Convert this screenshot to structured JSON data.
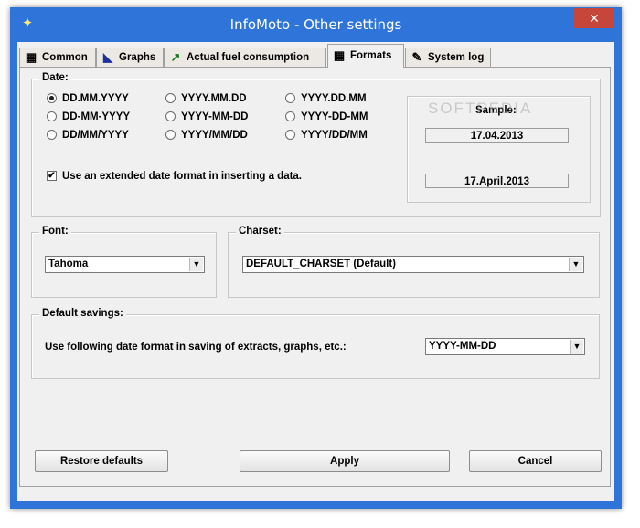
{
  "window": {
    "title": "InfoMoto - Other settings",
    "close_glyph": "✕"
  },
  "tabs": [
    {
      "label": "Common",
      "icon": "grid-icon"
    },
    {
      "label": "Graphs",
      "icon": "chart-icon"
    },
    {
      "label": "Actual fuel consumption",
      "icon": "line-chart-icon"
    },
    {
      "label": "Formats",
      "icon": "grid-icon",
      "active": true
    },
    {
      "label": "System log",
      "icon": "wrench-icon"
    }
  ],
  "date": {
    "group_label": "Date:",
    "formats": [
      {
        "label": "DD.MM.YYYY",
        "selected": true
      },
      {
        "label": "YYYY.MM.DD",
        "selected": false
      },
      {
        "label": "YYYY.DD.MM",
        "selected": false
      },
      {
        "label": "DD-MM-YYYY",
        "selected": false
      },
      {
        "label": "YYYY-MM-DD",
        "selected": false
      },
      {
        "label": "YYYY-DD-MM",
        "selected": false
      },
      {
        "label": "DD/MM/YYYY",
        "selected": false
      },
      {
        "label": "YYYY/MM/DD",
        "selected": false
      },
      {
        "label": "YYYY/DD/MM",
        "selected": false
      }
    ],
    "extended_checkbox_label": "Use an extended date format in inserting a data.",
    "extended_checked": true,
    "sample_label": "Sample:",
    "sample_short": "17.04.2013",
    "sample_long": "17.April.2013"
  },
  "font": {
    "group_label": "Font:",
    "value": "Tahoma"
  },
  "charset": {
    "group_label": "Charset:",
    "value": "DEFAULT_CHARSET (Default)"
  },
  "default_savings": {
    "group_label": "Default savings:",
    "description": "Use following date format in saving of extracts, graphs, etc.:",
    "value": "YYYY-MM-DD"
  },
  "buttons": {
    "restore": "Restore defaults",
    "apply": "Apply",
    "cancel": "Cancel"
  },
  "watermark": "SOFTPEDIA"
}
